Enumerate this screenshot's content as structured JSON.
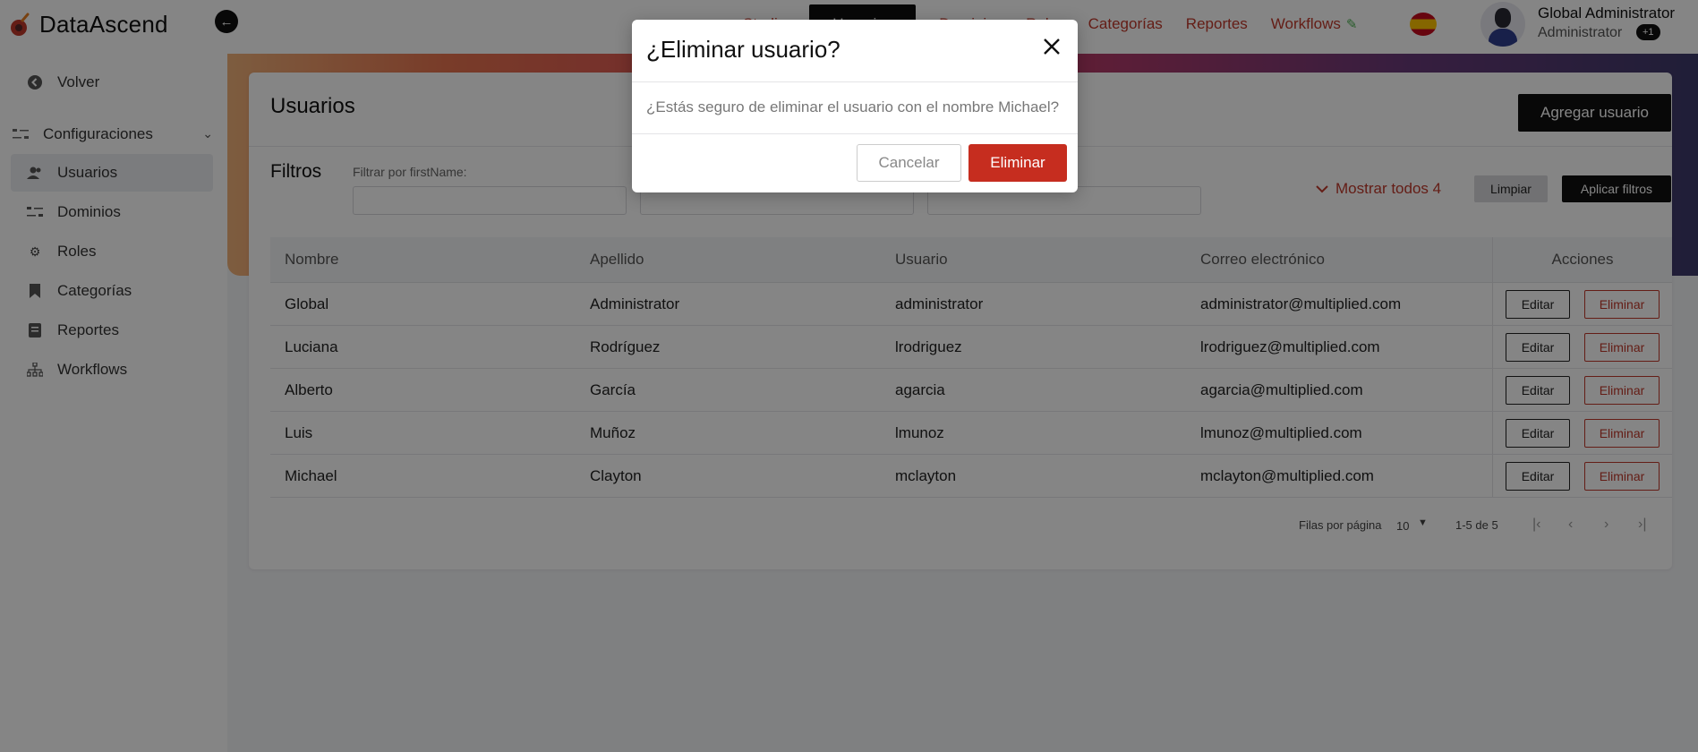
{
  "app": {
    "name": "DataAscend",
    "accent_color": "#c0392b",
    "primary_color": "#111111"
  },
  "topnav": {
    "items": [
      {
        "label": "Studio",
        "active": false
      },
      {
        "label": "Usuarios",
        "active": true
      },
      {
        "label": "Dominios",
        "active": false
      },
      {
        "label": "Roles",
        "active": false
      },
      {
        "label": "Categorías",
        "active": false
      },
      {
        "label": "Reportes",
        "active": false
      },
      {
        "label": "Workflows",
        "active": false
      }
    ],
    "language_flag": "spain-flag-icon"
  },
  "user": {
    "name": "Global Administrator",
    "role": "Administrator",
    "extra_roles_badge": "+1"
  },
  "sidebar": {
    "back_label": "Volver",
    "section_label": "Configuraciones",
    "items": [
      {
        "label": "Usuarios",
        "icon": "users-icon",
        "active": true
      },
      {
        "label": "Dominios",
        "icon": "domains-icon",
        "active": false
      },
      {
        "label": "Roles",
        "icon": "gear-icon",
        "active": false
      },
      {
        "label": "Categorías",
        "icon": "bookmark-icon",
        "active": false
      },
      {
        "label": "Reportes",
        "icon": "report-icon",
        "active": false
      },
      {
        "label": "Workflows",
        "icon": "workflow-icon",
        "active": false
      }
    ]
  },
  "page": {
    "title": "Usuarios",
    "add_button": "Agregar usuario"
  },
  "filters": {
    "title": "Filtros",
    "first_label": "Filtrar por firstName:",
    "show_all": "Mostrar todos 4",
    "clear_button": "Limpiar",
    "apply_button": "Aplicar filtros"
  },
  "table": {
    "headers": [
      "Nombre",
      "Apellido",
      "Usuario",
      "Correo electrónico",
      "Acciones"
    ],
    "edit_label": "Editar",
    "delete_label": "Eliminar",
    "rows": [
      [
        "Global",
        "Administrator",
        "administrator",
        "administrator@multiplied.com"
      ],
      [
        "Luciana",
        "Rodríguez",
        "lrodriguez",
        "lrodriguez@multiplied.com"
      ],
      [
        "Alberto",
        "García",
        "agarcia",
        "agarcia@multiplied.com"
      ],
      [
        "Luis",
        "Muñoz",
        "lmunoz",
        "lmunoz@multiplied.com"
      ],
      [
        "Michael",
        "Clayton",
        "mclayton",
        "mclayton@multiplied.com"
      ]
    ]
  },
  "pagination": {
    "rows_per_page_label": "Filas por página",
    "rows_per_page_value": "10",
    "range": "1-5 de 5"
  },
  "modal": {
    "title": "¿Eliminar usuario?",
    "body": "¿Estás seguro de eliminar el usuario con el nombre Michael?",
    "cancel": "Cancelar",
    "confirm": "Eliminar"
  }
}
